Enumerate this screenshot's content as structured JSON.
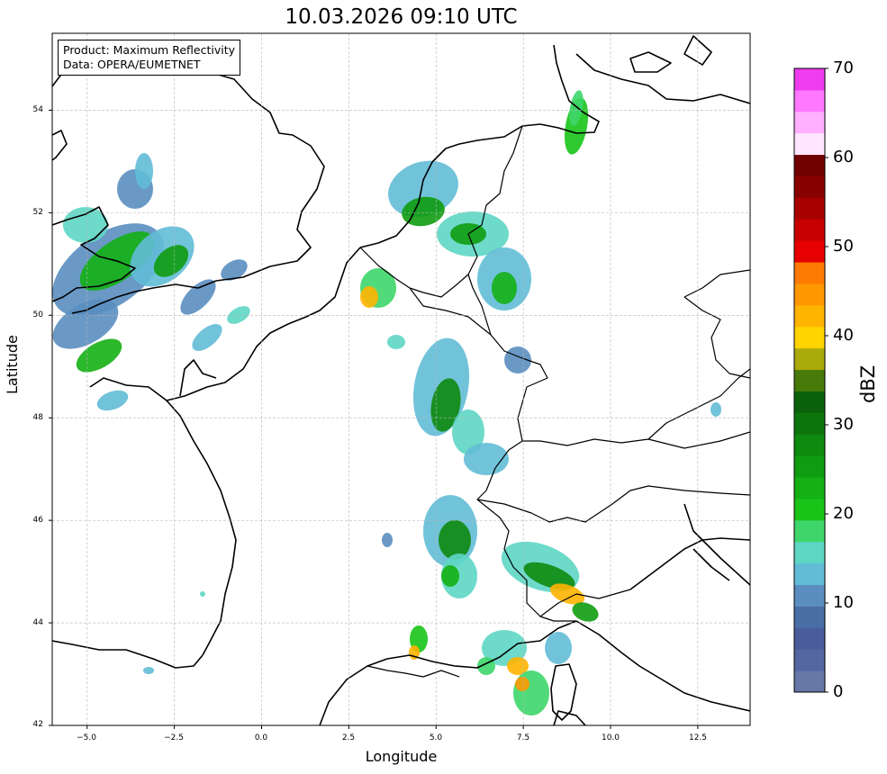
{
  "title": "10.03.2026 09:10 UTC",
  "info": {
    "product_line": "Product: Maximum Reflectivity",
    "data_line": "Data: OPERA/EUMETNET"
  },
  "xlabel": "Longitude",
  "ylabel": "Latitude",
  "xticks": [
    "−5.0",
    "−2.5",
    "0.0",
    "2.5",
    "5.0",
    "7.5",
    "10.0",
    "12.5"
  ],
  "yticks": [
    "54",
    "52",
    "50",
    "48",
    "46",
    "44",
    "42"
  ],
  "colorbar": {
    "label": "dBZ",
    "ticks": [
      "0",
      "10",
      "20",
      "30",
      "40",
      "50",
      "60",
      "70"
    ],
    "min": 0,
    "max": 70,
    "step": 2.5,
    "colors": [
      "#6677a8",
      "#5567a0",
      "#4a5c9c",
      "#4a6ea6",
      "#5a8ec0",
      "#62bcd6",
      "#5ed6c4",
      "#3ed66a",
      "#18c418",
      "#14b014",
      "#109c10",
      "#0e8a0e",
      "#0c760c",
      "#0c620c",
      "#487a0a",
      "#aaaa0a",
      "#ffd400",
      "#ffb400",
      "#ff9800",
      "#ff7a00",
      "#e60000",
      "#c80000",
      "#a80000",
      "#880000",
      "#700000",
      "#ffe6ff",
      "#ffb0ff",
      "#ff78ff",
      "#ee3cee"
    ]
  },
  "map": {
    "lon_range": [
      -6,
      14
    ],
    "lat_range": [
      42,
      55.5
    ],
    "projection": "plate-carree",
    "grid": true
  }
}
